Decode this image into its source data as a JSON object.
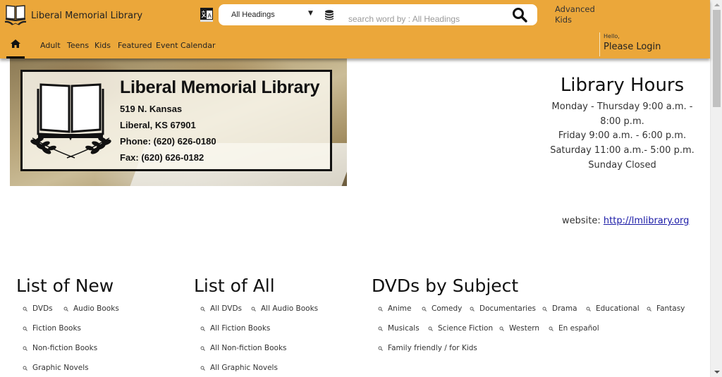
{
  "header": {
    "site_title": "Liberal Memorial Library",
    "search": {
      "select_value": "All Headings",
      "placeholder": "search word by : All Headings"
    },
    "advanced_links": [
      "Advanced",
      "Kids"
    ],
    "nav": [
      "Adult",
      "Teens",
      "Kids",
      "Featured",
      "Event Calendar"
    ],
    "login": {
      "greeting": "Hello,",
      "label": "Please Login"
    },
    "colors": {
      "header_bg": "#eba73a"
    }
  },
  "banner": {
    "title": "Liberal Memorial Library",
    "address_line1": "519 N. Kansas",
    "address_line2": "Liberal, KS 67901",
    "phone": "Phone: (620) 626-0180",
    "fax": "Fax: (620) 626-0182"
  },
  "hours": {
    "title": "Library Hours",
    "lines": [
      "Monday - Thursday 9:00 a.m. - 8:00 p.m.",
      "Friday 9:00 a.m. - 6:00 p.m.",
      "Saturday 11:00 a.m.- 5:00 p.m.",
      "Sunday Closed"
    ],
    "website_label": "website:",
    "website_url": "http://lmlibrary.org"
  },
  "sections": {
    "new": {
      "title": "List of New",
      "items": [
        "DVDs",
        "Audio Books",
        "Fiction Books",
        "Non-fiction Books",
        "Graphic Novels"
      ]
    },
    "all": {
      "title": "List of All",
      "items": [
        "All DVDs",
        "All Audio Books",
        "All Fiction Books",
        "All Non-fiction Books",
        "All Graphic Novels"
      ]
    },
    "dvds": {
      "title": "DVDs by Subject",
      "items": [
        "Anime",
        "Comedy",
        "Documentaries",
        "Drama",
        "Educational",
        "Fantasy",
        "Musicals",
        "Science Fiction",
        "Western",
        "En español",
        "Family friendly / for Kids"
      ]
    }
  },
  "icons": {
    "logo": "open-book-laurel-icon",
    "language": "translate-icon",
    "database": "database-icon",
    "search": "search-icon",
    "home": "home-icon",
    "list_bullet": "magnifier-icon"
  }
}
